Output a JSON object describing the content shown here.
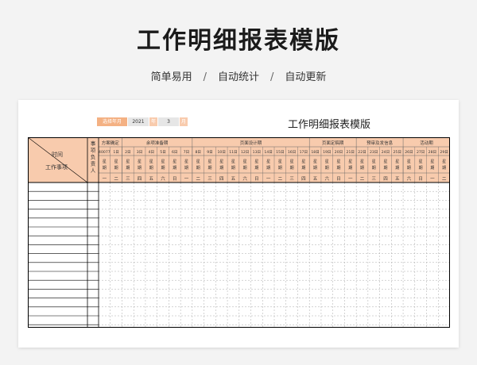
{
  "page": {
    "title": "工作明细报表模版",
    "subtitle": [
      "简单易用",
      "自动统计",
      "自动更新"
    ],
    "separator": "/"
  },
  "sheet": {
    "title": "工作明细报表模版",
    "selector": {
      "label": "选择年月",
      "year": "2021",
      "year_unit": "年",
      "month": "3",
      "month_unit": "月"
    },
    "corner": {
      "top": "时间",
      "bottom": "工作事项"
    },
    "responsible_header": "事项负责人",
    "phases": [
      {
        "label": "方案确定"
      },
      {
        "label": "余项准备期"
      },
      {
        "label": "页面设计期"
      },
      {
        "label": "页面定稿期"
      },
      {
        "label": "预审及发信息"
      },
      {
        "label": "活动期"
      }
    ],
    "date_start_label": "40077",
    "dates": [
      "1日",
      "2日",
      "3日",
      "4日",
      "5日",
      "6日",
      "7日",
      "8日",
      "9日",
      "10日",
      "11日",
      "12日",
      "13日",
      "14日",
      "15日",
      "16日",
      "17日",
      "18日",
      "19日",
      "20日",
      "21日",
      "22日",
      "23日",
      "24日",
      "25日",
      "26日",
      "27日",
      "28日",
      "29日"
    ],
    "week_label": "星期",
    "weekdays": [
      "一",
      "二",
      "三",
      "四",
      "五",
      "六",
      "日",
      "一",
      "二",
      "三",
      "四",
      "五",
      "六",
      "日",
      "一",
      "二",
      "三",
      "四",
      "五",
      "六",
      "日",
      "一",
      "二",
      "三",
      "四",
      "五",
      "六",
      "日",
      "一",
      "二"
    ],
    "colors": {
      "header_fill": "#f8cbad",
      "selector_fill": "#f4b183",
      "border": "#000000"
    }
  }
}
